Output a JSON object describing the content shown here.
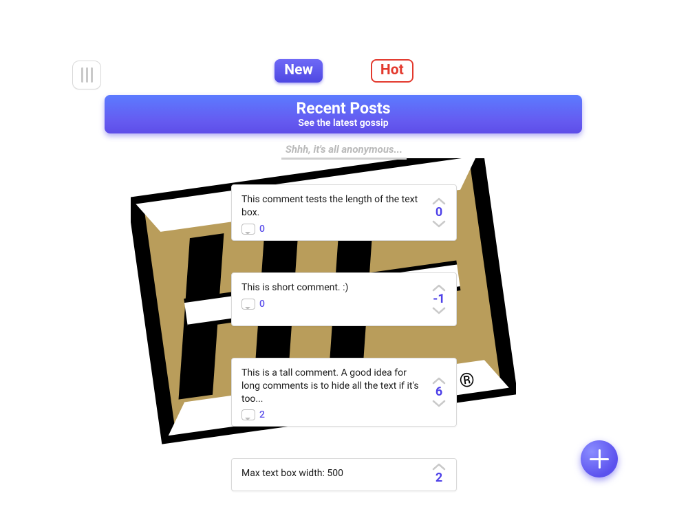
{
  "tabs": {
    "new_label": "New",
    "hot_label": "Hot"
  },
  "banner": {
    "title": "Recent Posts",
    "subtitle": "See the latest gossip"
  },
  "compose": {
    "placeholder": "Shhh, it's all anonymous..."
  },
  "posts": [
    {
      "text": "This comment tests the length of the text box.",
      "comments": "0",
      "score": "0"
    },
    {
      "text": "This is short comment. :)",
      "comments": "0",
      "score": "-1"
    },
    {
      "text": "This is a tall comment.  A good idea for long comments is to hide all the text if it's too...",
      "comments": "2",
      "score": "6"
    },
    {
      "text": "Max text box width: 500",
      "comments": "",
      "score": "2"
    }
  ],
  "icons": {
    "menu": "menu-icon",
    "compose_fab": "plus-icon"
  }
}
